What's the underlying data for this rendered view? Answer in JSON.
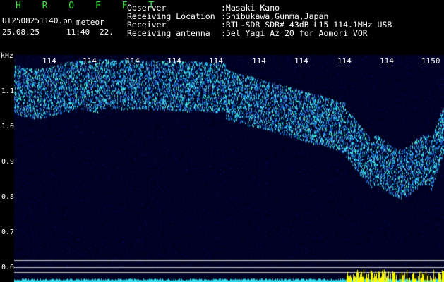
{
  "header": {
    "brand": "H R O F F T",
    "file_name": "UT2508251140.pn",
    "file_tag": "meteor",
    "date": "25.08.25",
    "time": "11:40",
    "counter": "22.",
    "info": [
      {
        "label": "Observer",
        "value": ":Masaki Kano"
      },
      {
        "label": "Receiving Location",
        "value": ":Shibukawa,Gunma,Japan"
      },
      {
        "label": "Receiver",
        "value": ":RTL-SDR SDR# 43dB L15 114.1MHz USB"
      },
      {
        "label": "Receiving antenna",
        "value": ":5el Yagi Az 20 for Aomori VOR"
      }
    ]
  },
  "spectrogram": {
    "y_unit": "kHz",
    "y_ticks": [
      "1.1",
      "1.0",
      "0.9",
      "0.8",
      "0.7",
      "0.6"
    ],
    "x_ticks": [
      "114",
      "114",
      "114",
      "114",
      "114",
      "114",
      "114",
      "114",
      "114",
      "1150"
    ],
    "colors": {
      "background": "#000022",
      "trace": "#33ddee",
      "hot": "#ffff00",
      "guide": "#c8c8c8"
    }
  }
}
